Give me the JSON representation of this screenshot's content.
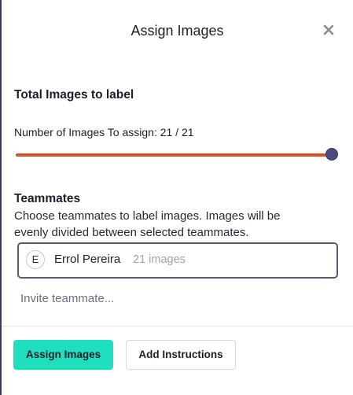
{
  "dialog": {
    "title": "Assign Images",
    "close_icon": "close-icon"
  },
  "total": {
    "heading": "Total Images to label",
    "slider_label": "Number of Images To assign: 21 / 21",
    "assigned": 21,
    "max": 21,
    "fill_color": "#d9501e",
    "thumb_color": "#4a4a80"
  },
  "teammates": {
    "heading": "Teammates",
    "description": "Choose teammates to label images. Images will be evenly divided between selected teammates.",
    "members": [
      {
        "initial": "E",
        "name": "Errol Pereira",
        "images": "21 images"
      }
    ],
    "invite_placeholder": "Invite teammate..."
  },
  "footer": {
    "assign_label": "Assign Images",
    "instructions_label": "Add Instructions",
    "assign_color": "#1fe0be"
  }
}
